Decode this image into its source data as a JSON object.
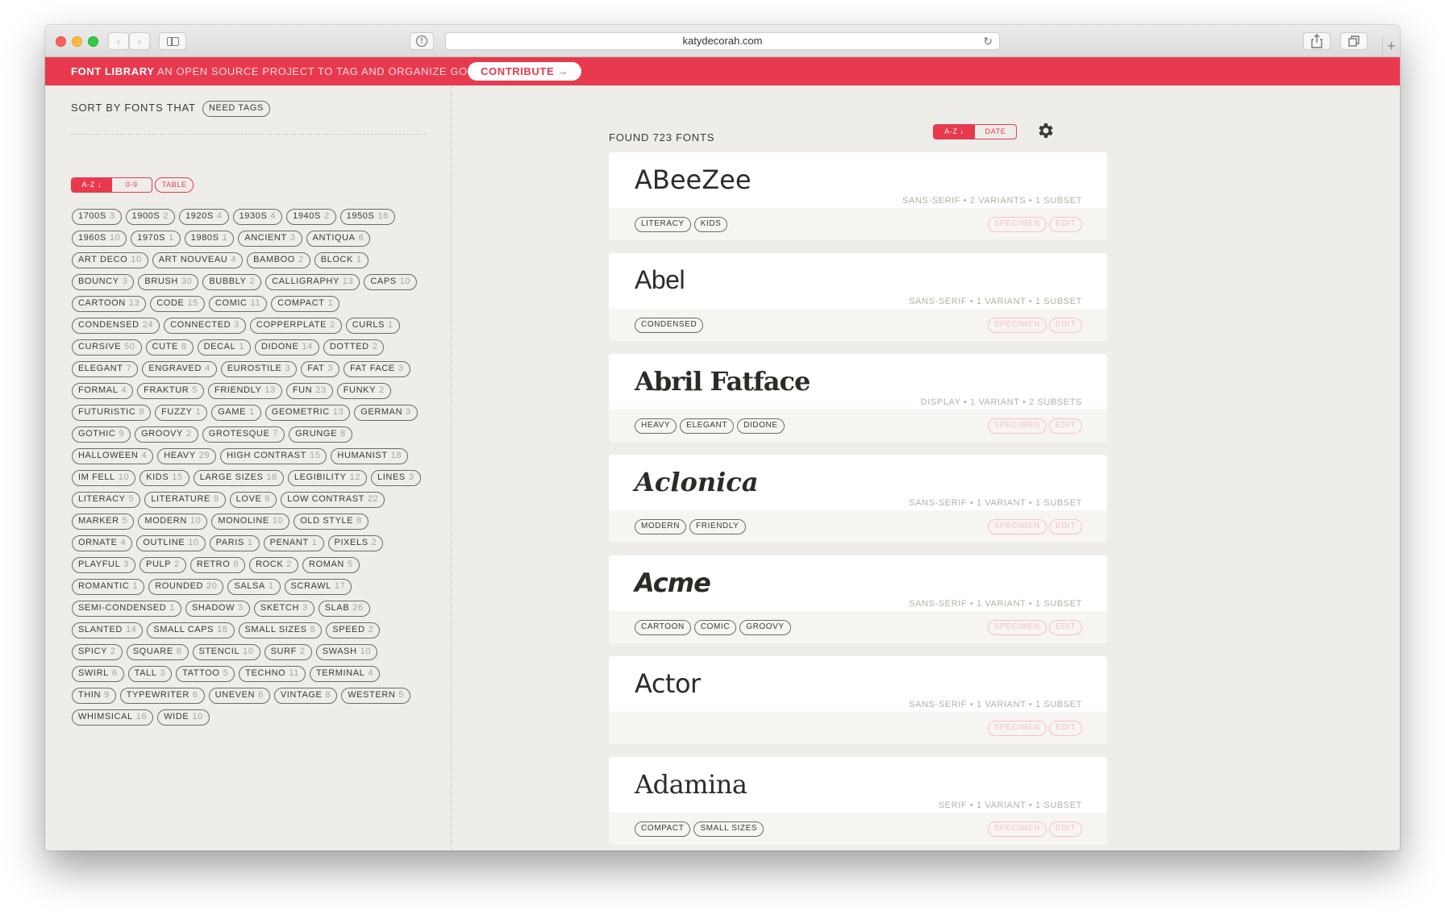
{
  "browser": {
    "url": "katydecorah.com"
  },
  "banner": {
    "brand": "FONT LIBRARY",
    "tagline": " AN OPEN SOURCE PROJECT TO TAG AND ORGANIZE GOOGLE FONTS.",
    "contribute_label": "CONTRIBUTE →"
  },
  "sidebar": {
    "sort_label": "SORT BY FONTS THAT",
    "need_tags_label": "NEED TAGS",
    "sort_az_label": "A-Z ↓",
    "sort_09_label": "0-9",
    "table_label": "TABLE",
    "tags": [
      {
        "name": "1700S",
        "count": "3"
      },
      {
        "name": "1900S",
        "count": "2"
      },
      {
        "name": "1920S",
        "count": "4"
      },
      {
        "name": "1930S",
        "count": "4"
      },
      {
        "name": "1940S",
        "count": "2"
      },
      {
        "name": "1950S",
        "count": "16"
      },
      {
        "name": "1960S",
        "count": "10"
      },
      {
        "name": "1970S",
        "count": "1"
      },
      {
        "name": "1980S",
        "count": "1"
      },
      {
        "name": "ANCIENT",
        "count": "3"
      },
      {
        "name": "ANTIQUA",
        "count": "6"
      },
      {
        "name": "ART DECO",
        "count": "10"
      },
      {
        "name": "ART NOUVEAU",
        "count": "4"
      },
      {
        "name": "BAMBOO",
        "count": "2"
      },
      {
        "name": "BLOCK",
        "count": "1"
      },
      {
        "name": "BOUNCY",
        "count": "3"
      },
      {
        "name": "BRUSH",
        "count": "30"
      },
      {
        "name": "BUBBLY",
        "count": "2"
      },
      {
        "name": "CALLIGRAPHY",
        "count": "13"
      },
      {
        "name": "CAPS",
        "count": "10"
      },
      {
        "name": "CARTOON",
        "count": "13"
      },
      {
        "name": "CODE",
        "count": "15"
      },
      {
        "name": "COMIC",
        "count": "11"
      },
      {
        "name": "COMPACT",
        "count": "1"
      },
      {
        "name": "CONDENSED",
        "count": "24"
      },
      {
        "name": "CONNECTED",
        "count": "3"
      },
      {
        "name": "COPPERPLATE",
        "count": "2"
      },
      {
        "name": "CURLS",
        "count": "1"
      },
      {
        "name": "CURSIVE",
        "count": "50"
      },
      {
        "name": "CUTE",
        "count": "8"
      },
      {
        "name": "DECAL",
        "count": "1"
      },
      {
        "name": "DIDONE",
        "count": "14"
      },
      {
        "name": "DOTTED",
        "count": "2"
      },
      {
        "name": "ELEGANT",
        "count": "7"
      },
      {
        "name": "ENGRAVED",
        "count": "4"
      },
      {
        "name": "EUROSTILE",
        "count": "3"
      },
      {
        "name": "FAT",
        "count": "3"
      },
      {
        "name": "FAT FACE",
        "count": "3"
      },
      {
        "name": "FORMAL",
        "count": "4"
      },
      {
        "name": "FRAKTUR",
        "count": "5"
      },
      {
        "name": "FRIENDLY",
        "count": "13"
      },
      {
        "name": "FUN",
        "count": "23"
      },
      {
        "name": "FUNKY",
        "count": "2"
      },
      {
        "name": "FUTURISTIC",
        "count": "8"
      },
      {
        "name": "FUZZY",
        "count": "1"
      },
      {
        "name": "GAME",
        "count": "1"
      },
      {
        "name": "GEOMETRIC",
        "count": "13"
      },
      {
        "name": "GERMAN",
        "count": "3"
      },
      {
        "name": "GOTHIC",
        "count": "9"
      },
      {
        "name": "GROOVY",
        "count": "2"
      },
      {
        "name": "GROTESQUE",
        "count": "7"
      },
      {
        "name": "GRUNGE",
        "count": "8"
      },
      {
        "name": "HALLOWEEN",
        "count": "4"
      },
      {
        "name": "HEAVY",
        "count": "29"
      },
      {
        "name": "HIGH CONTRAST",
        "count": "15"
      },
      {
        "name": "HUMANIST",
        "count": "18"
      },
      {
        "name": "IM FELL",
        "count": "10"
      },
      {
        "name": "KIDS",
        "count": "15"
      },
      {
        "name": "LARGE SIZES",
        "count": "18"
      },
      {
        "name": "LEGIBILITY",
        "count": "12"
      },
      {
        "name": "LINES",
        "count": "3"
      },
      {
        "name": "LITERACY",
        "count": "5"
      },
      {
        "name": "LITERATURE",
        "count": "9"
      },
      {
        "name": "LOVE",
        "count": "8"
      },
      {
        "name": "LOW CONTRAST",
        "count": "22"
      },
      {
        "name": "MARKER",
        "count": "5"
      },
      {
        "name": "MODERN",
        "count": "10"
      },
      {
        "name": "MONOLINE",
        "count": "10"
      },
      {
        "name": "OLD STYLE",
        "count": "8"
      },
      {
        "name": "ORNATE",
        "count": "4"
      },
      {
        "name": "OUTLINE",
        "count": "10"
      },
      {
        "name": "PARIS",
        "count": "1"
      },
      {
        "name": "PENANT",
        "count": "1"
      },
      {
        "name": "PIXELS",
        "count": "2"
      },
      {
        "name": "PLAYFUL",
        "count": "3"
      },
      {
        "name": "PULP",
        "count": "2"
      },
      {
        "name": "RETRO",
        "count": "8"
      },
      {
        "name": "ROCK",
        "count": "2"
      },
      {
        "name": "ROMAN",
        "count": "5"
      },
      {
        "name": "ROMANTIC",
        "count": "1"
      },
      {
        "name": "ROUNDED",
        "count": "20"
      },
      {
        "name": "SALSA",
        "count": "1"
      },
      {
        "name": "SCRAWL",
        "count": "17"
      },
      {
        "name": "SEMI-CONDENSED",
        "count": "1"
      },
      {
        "name": "SHADOW",
        "count": "3"
      },
      {
        "name": "SKETCH",
        "count": "3"
      },
      {
        "name": "SLAB",
        "count": "26"
      },
      {
        "name": "SLANTED",
        "count": "14"
      },
      {
        "name": "SMALL CAPS",
        "count": "18"
      },
      {
        "name": "SMALL SIZES",
        "count": "8"
      },
      {
        "name": "SPEED",
        "count": "2"
      },
      {
        "name": "SPICY",
        "count": "2"
      },
      {
        "name": "SQUARE",
        "count": "8"
      },
      {
        "name": "STENCIL",
        "count": "10"
      },
      {
        "name": "SURF",
        "count": "2"
      },
      {
        "name": "SWASH",
        "count": "10"
      },
      {
        "name": "SWIRL",
        "count": "6"
      },
      {
        "name": "TALL",
        "count": "3"
      },
      {
        "name": "TATTOO",
        "count": "5"
      },
      {
        "name": "TECHNO",
        "count": "11"
      },
      {
        "name": "TERMINAL",
        "count": "4"
      },
      {
        "name": "THIN",
        "count": "9"
      },
      {
        "name": "TYPEWRITER",
        "count": "6"
      },
      {
        "name": "UNEVEN",
        "count": "6"
      },
      {
        "name": "VINTAGE",
        "count": "8"
      },
      {
        "name": "WESTERN",
        "count": "5"
      },
      {
        "name": "WHIMSICAL",
        "count": "16"
      },
      {
        "name": "WIDE",
        "count": "10"
      }
    ]
  },
  "main": {
    "found_label": "FOUND 723 FONTS",
    "sort_az_label": "A-Z ↓",
    "sort_date_label": "DATE",
    "specimen_label": "SPECIMEN",
    "edit_label": "EDIT",
    "fonts": [
      {
        "name": "ABeeZee",
        "meta": "SANS-SERIF • 2 VARIANTS • 1 SUBSET",
        "tags": [
          "LITERACY",
          "KIDS"
        ]
      },
      {
        "name": "Abel",
        "meta": "SANS-SERIF • 1 VARIANT • 1 SUBSET",
        "tags": [
          "CONDENSED"
        ]
      },
      {
        "name": "Abril Fatface",
        "meta": "DISPLAY • 1 VARIANT • 2 SUBSETS",
        "tags": [
          "HEAVY",
          "ELEGANT",
          "DIDONE"
        ]
      },
      {
        "name": "Aclonica",
        "meta": "SANS-SERIF • 1 VARIANT • 1 SUBSET",
        "tags": [
          "MODERN",
          "FRIENDLY"
        ]
      },
      {
        "name": "Acme",
        "meta": "SANS-SERIF • 1 VARIANT • 1 SUBSET",
        "tags": [
          "CARTOON",
          "COMIC",
          "GROOVY"
        ]
      },
      {
        "name": "Actor",
        "meta": "SANS-SERIF • 1 VARIANT • 1 SUBSET",
        "tags": []
      },
      {
        "name": "Adamina",
        "meta": "SERIF • 1 VARIANT • 1 SUBSET",
        "tags": [
          "COMPACT",
          "SMALL SIZES"
        ]
      }
    ]
  },
  "colors": {
    "accent": "#e8394f",
    "background": "#efede9",
    "card": "#ffffff"
  }
}
